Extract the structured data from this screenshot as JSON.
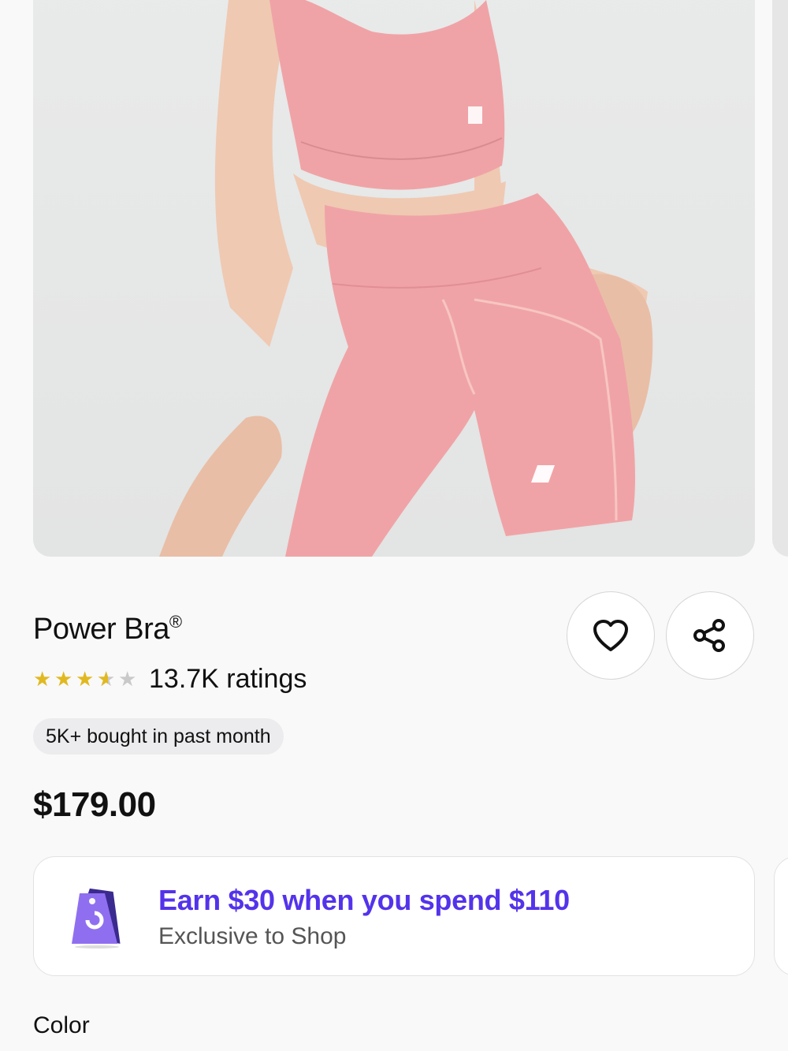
{
  "product": {
    "title": "Power Bra",
    "title_mark": "®",
    "rating": {
      "value_stars": 3.5,
      "max_stars": 5,
      "count_label": "13.7K ratings",
      "star_color": "#e1b91f"
    },
    "bought_badge": "5K+ bought in past month",
    "price": "$179.00",
    "image_palette": {
      "background": "#e6e7e7",
      "garment": "#f0a3a6",
      "skin": "#efc9b2"
    }
  },
  "actions": {
    "favorite_icon": "heart-icon",
    "share_icon": "share-icon"
  },
  "promo": {
    "title": "Earn $30 when you spend $110",
    "subtitle": "Exclusive to Shop",
    "icon": "shop-tag-icon",
    "accent_color": "#5433eb"
  },
  "sections": {
    "color_label": "Color"
  }
}
